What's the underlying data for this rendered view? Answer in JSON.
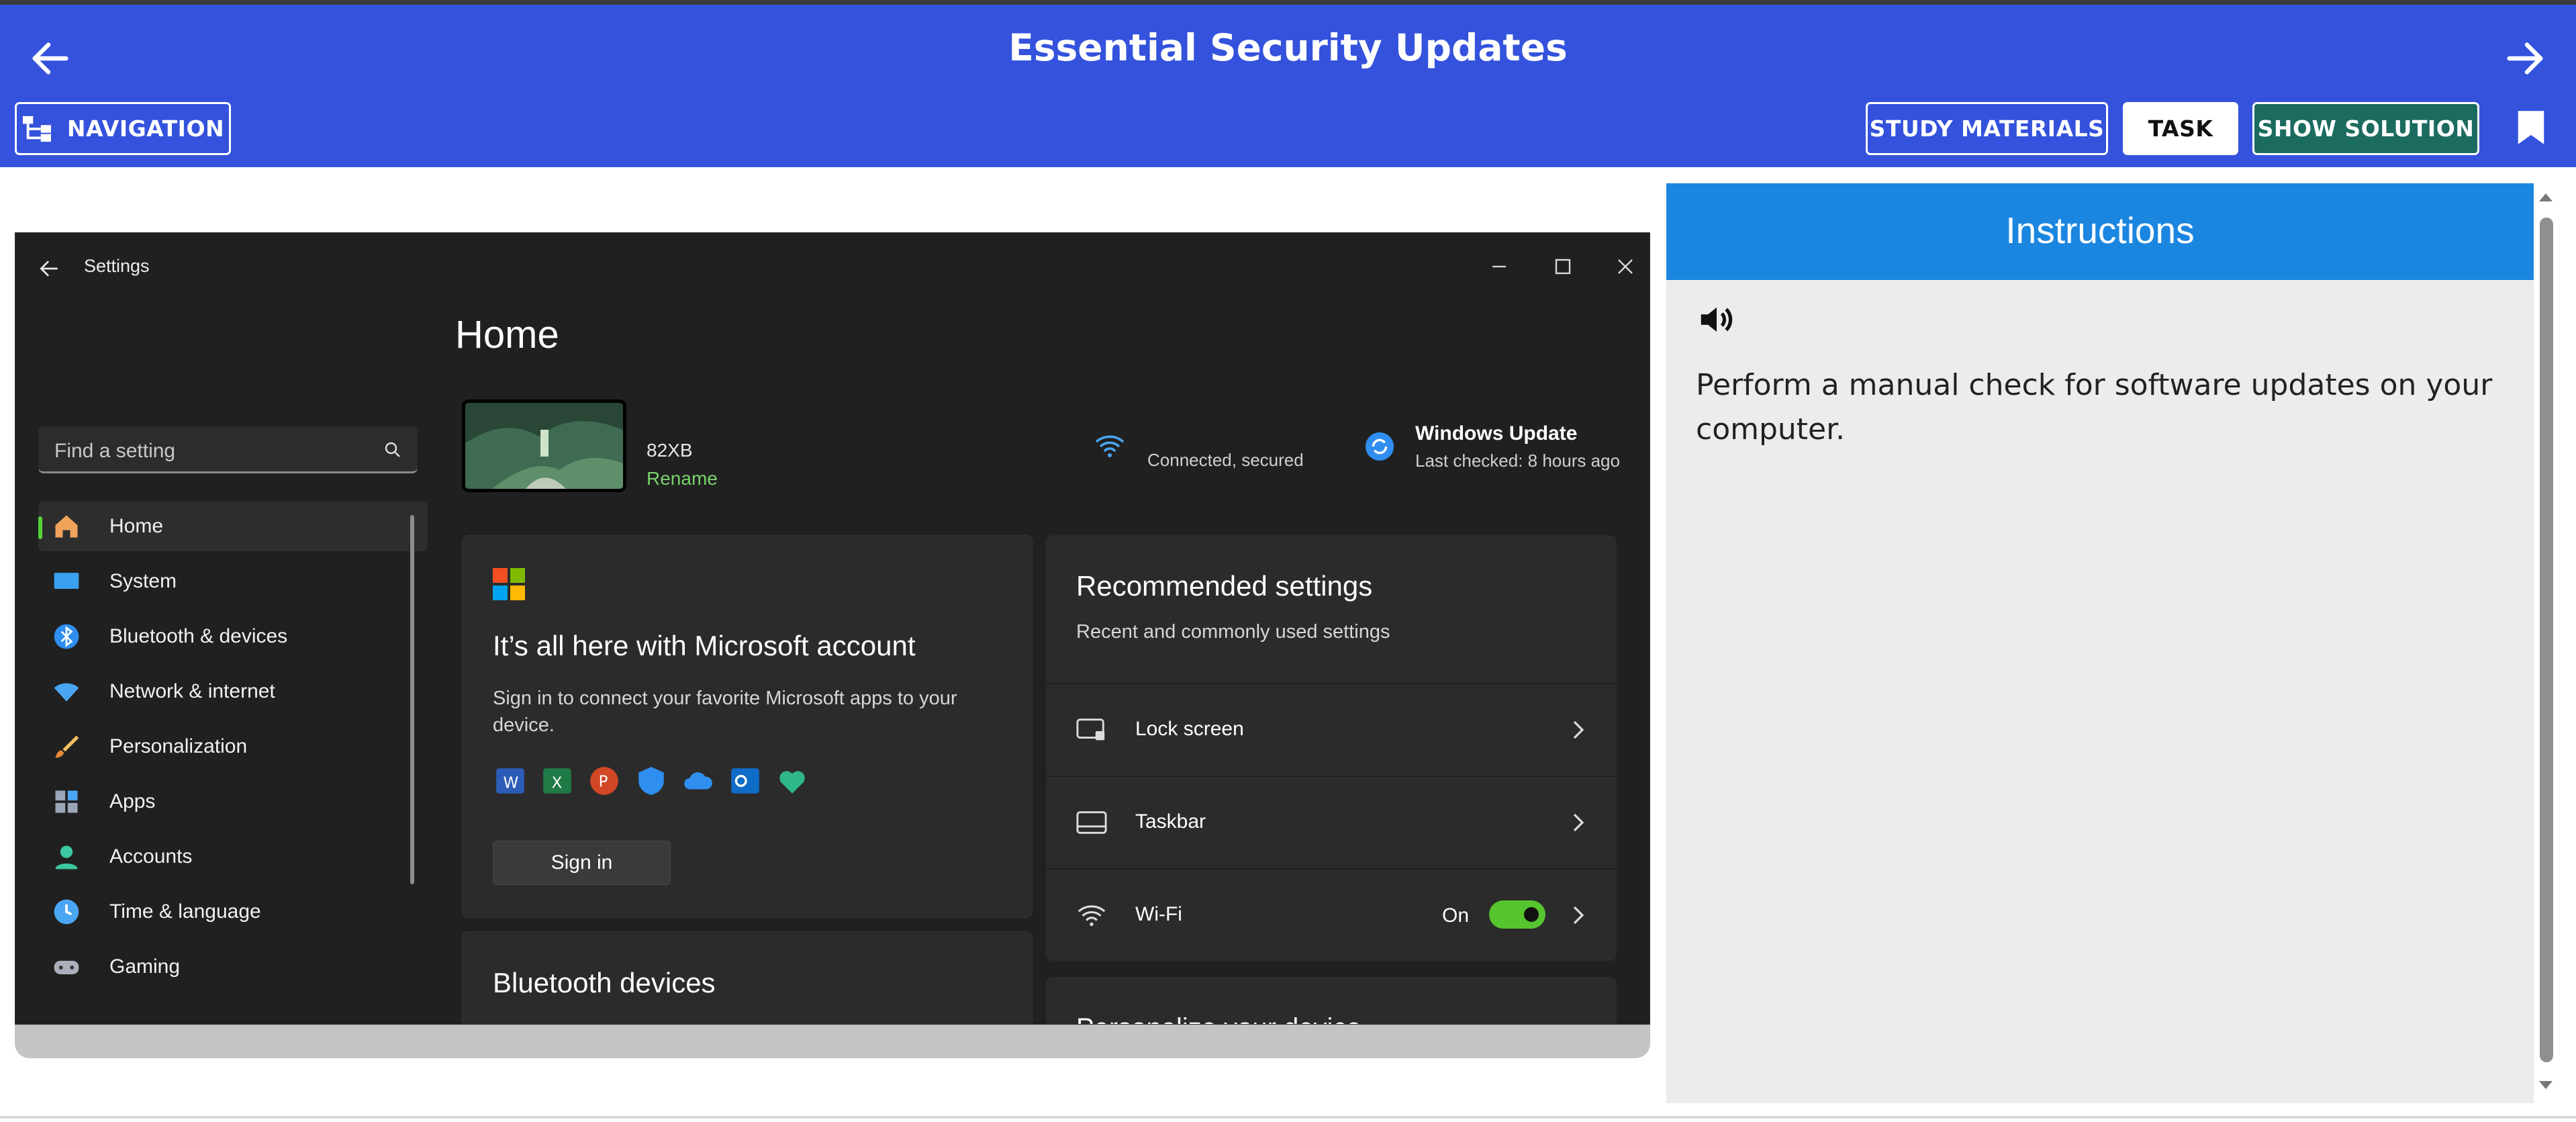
{
  "header": {
    "title": "Essential Security Updates",
    "back_icon": "arrow-left-icon",
    "forward_icon": "arrow-right-icon",
    "buttons": {
      "navigation": "NAVIGATION",
      "study_materials": "STUDY MATERIALS",
      "task": "TASK",
      "show_solution": "SHOW SOLUTION"
    },
    "colors": {
      "bar": "#3452dc",
      "solution_button": "#1b6b5f"
    }
  },
  "settings_window": {
    "app_title": "Settings",
    "search_placeholder": "Find a setting",
    "page_title": "Home",
    "sidebar": [
      {
        "label": "Home",
        "icon": "home-icon",
        "active": true
      },
      {
        "label": "System",
        "icon": "system-icon"
      },
      {
        "label": "Bluetooth & devices",
        "icon": "bluetooth-icon"
      },
      {
        "label": "Network & internet",
        "icon": "network-icon"
      },
      {
        "label": "Personalization",
        "icon": "brush-icon"
      },
      {
        "label": "Apps",
        "icon": "apps-icon"
      },
      {
        "label": "Accounts",
        "icon": "accounts-icon"
      },
      {
        "label": "Time & language",
        "icon": "time-language-icon"
      },
      {
        "label": "Gaming",
        "icon": "gaming-icon"
      }
    ],
    "device": {
      "name": "82XB",
      "rename": "Rename"
    },
    "wifi_status": "Connected, secured",
    "windows_update": {
      "title": "Windows Update",
      "subtitle": "Last checked: 8 hours ago"
    },
    "ms_account_card": {
      "title": "It’s all here with Microsoft account",
      "description": "Sign in to connect your favorite Microsoft apps to your device.",
      "apps": [
        "word-icon",
        "excel-icon",
        "powerpoint-icon",
        "defender-icon",
        "onedrive-icon",
        "outlook-icon",
        "family-icon"
      ],
      "sign_in": "Sign in"
    },
    "bluetooth_card": {
      "title": "Bluetooth devices"
    },
    "recommended": {
      "title": "Recommended settings",
      "subtitle": "Recent and commonly used settings",
      "rows": [
        {
          "label": "Lock screen",
          "icon": "lock-screen-icon"
        },
        {
          "label": "Taskbar",
          "icon": "taskbar-icon"
        },
        {
          "label": "Wi-Fi",
          "icon": "wifi-icon",
          "state": "On",
          "toggle_on": true
        }
      ],
      "next_card_title": "Personalize your device"
    },
    "accent": "#56c42e"
  },
  "instructions": {
    "title": "Instructions",
    "speaker_icon": "speaker-icon",
    "text": "Perform a manual check for software updates on your computer.",
    "header_color": "#1b86e0"
  }
}
